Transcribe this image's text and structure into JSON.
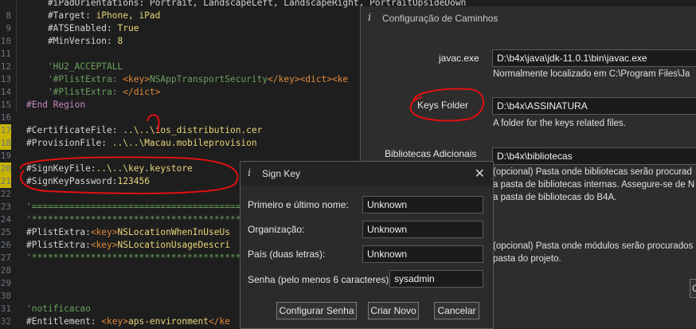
{
  "editor": {
    "lines": [
      {
        "num": "",
        "gut": "",
        "text": "    #iPadOrientations: Portrait, LandscapeLeft, LandscapeRight, PortraitUpsideDown",
        "cls": "c-def"
      },
      {
        "num": "8",
        "gut": "",
        "parts": [
          {
            "t": "    #Target: ",
            "c": "c-def"
          },
          {
            "t": "iPhone, iPad",
            "c": "c-str"
          }
        ]
      },
      {
        "num": "9",
        "gut": "",
        "parts": [
          {
            "t": "    #ATSEnabled: ",
            "c": "c-def"
          },
          {
            "t": "True",
            "c": "c-str"
          }
        ]
      },
      {
        "num": "10",
        "gut": "",
        "parts": [
          {
            "t": "    #MinVersion: ",
            "c": "c-def"
          },
          {
            "t": "8",
            "c": "c-str"
          }
        ]
      },
      {
        "num": "11",
        "gut": "",
        "text": "",
        "cls": "c-def"
      },
      {
        "num": "12",
        "gut": "",
        "text": "    'HU2_ACCEPTALL",
        "cls": "c-cmt"
      },
      {
        "num": "13",
        "gut": "",
        "parts": [
          {
            "t": "    '#PlistExtra: ",
            "c": "c-cmt"
          },
          {
            "t": "<key>",
            "c": "c-tag"
          },
          {
            "t": "NSAppTransportSecurity",
            "c": "c-cmt"
          },
          {
            "t": "</key><dict><ke",
            "c": "c-tag"
          }
        ]
      },
      {
        "num": "14",
        "gut": "",
        "parts": [
          {
            "t": "    '#PlistExtra: ",
            "c": "c-cmt"
          },
          {
            "t": "</dict>",
            "c": "c-tag"
          }
        ]
      },
      {
        "num": "15",
        "gut": "",
        "text": "#End Region",
        "cls": "c-kw"
      },
      {
        "num": "16",
        "gut": "",
        "text": "",
        "cls": "c-def"
      },
      {
        "num": "17",
        "gut": "y",
        "parts": [
          {
            "t": "#CertificateFile: ",
            "c": "c-def"
          },
          {
            "t": "..\\..\\ios_distribution.cer",
            "c": "c-str"
          }
        ]
      },
      {
        "num": "18",
        "gut": "y",
        "parts": [
          {
            "t": "#ProvisionFile: ",
            "c": "c-def"
          },
          {
            "t": "..\\..\\Macau.mobileprovision",
            "c": "c-str"
          }
        ]
      },
      {
        "num": "19",
        "gut": "",
        "text": "",
        "cls": "c-def"
      },
      {
        "num": "20",
        "gut": "y",
        "parts": [
          {
            "t": "#SignKeyFile:",
            "c": "c-def"
          },
          {
            "t": "..\\..\\key.keystore",
            "c": "c-str"
          }
        ]
      },
      {
        "num": "21",
        "gut": "y",
        "parts": [
          {
            "t": "#SignKeyPassword:",
            "c": "c-def"
          },
          {
            "t": "123456",
            "c": "c-str"
          }
        ]
      },
      {
        "num": "22",
        "gut": "",
        "text": "",
        "cls": "c-def"
      },
      {
        "num": "23",
        "gut": "",
        "text": "'=====================================================",
        "cls": "c-cmt"
      },
      {
        "num": "24",
        "gut": "",
        "text": "'*****************************************************",
        "cls": "c-cmt"
      },
      {
        "num": "25",
        "gut": "",
        "parts": [
          {
            "t": "#PlistExtra:",
            "c": "c-def"
          },
          {
            "t": "<key>",
            "c": "c-tag"
          },
          {
            "t": "NSLocationWhenInUseUs",
            "c": "c-str"
          }
        ]
      },
      {
        "num": "26",
        "gut": "",
        "parts": [
          {
            "t": "#PlistExtra:",
            "c": "c-def"
          },
          {
            "t": "<key>",
            "c": "c-tag"
          },
          {
            "t": "NSLocationUsageDescri",
            "c": "c-str"
          }
        ]
      },
      {
        "num": "27",
        "gut": "",
        "text": "'*****************************************************",
        "cls": "c-cmt"
      },
      {
        "num": "28",
        "gut": "",
        "text": "",
        "cls": "c-def"
      },
      {
        "num": "29",
        "gut": "",
        "text": "",
        "cls": "c-def"
      },
      {
        "num": "30",
        "gut": "",
        "text": "",
        "cls": "c-def"
      },
      {
        "num": "31",
        "gut": "",
        "text": "'notificacao",
        "cls": "c-cmt"
      },
      {
        "num": "32",
        "gut": "",
        "parts": [
          {
            "t": "#Entitlement: ",
            "c": "c-def"
          },
          {
            "t": "<key>",
            "c": "c-tag"
          },
          {
            "t": "aps-environment",
            "c": "c-str"
          },
          {
            "t": "</ke",
            "c": "c-tag"
          }
        ]
      }
    ]
  },
  "paths_dialog": {
    "title": "Configuração de Caminhos",
    "javac_label": "javac.exe",
    "javac_value": "D:\\b4x\\java\\jdk-11.0.1\\bin\\javac.exe",
    "javac_hint": "Normalmente localizado em C:\\Program Files\\Ja",
    "keys_label": "Keys Folder",
    "keys_value": "D:\\b4x\\ASSINATURA",
    "keys_hint": "A folder for the keys related files.",
    "libs_label": "Bibliotecas Adicionais",
    "libs_value": "D:\\b4x\\bibliotecas",
    "libs_hint_1": "(opcional) Pasta onde bibliotecas serão procurad",
    "libs_hint_2": "a pasta de bibliotecas internas. Assegure-se de N",
    "libs_hint_3": "a pasta de bibliotecas do B4A.",
    "mods_hint_1": "(opcional) Pasta onde módulos serão procurados",
    "mods_hint_2": "pasta do projeto.",
    "partial_button": "C"
  },
  "signkey_dialog": {
    "title": "Sign Key",
    "name_label": "Primeiro e último nome:",
    "name_value": "Unknown",
    "org_label": "Organização:",
    "org_value": "Unknown",
    "country_label": "País (duas letras):",
    "country_value": "Unknown",
    "pass_label": "Senha (pelo menos 6 caracteres):",
    "pass_value": "sysadmin",
    "btn_config": "Configurar Senha",
    "btn_create": "Criar Novo",
    "btn_cancel": "Cancelar"
  },
  "colors": {
    "annotation": "#e01010",
    "editor_bg": "#1e1e1e",
    "dialog_bg": "#2d2d2d"
  }
}
